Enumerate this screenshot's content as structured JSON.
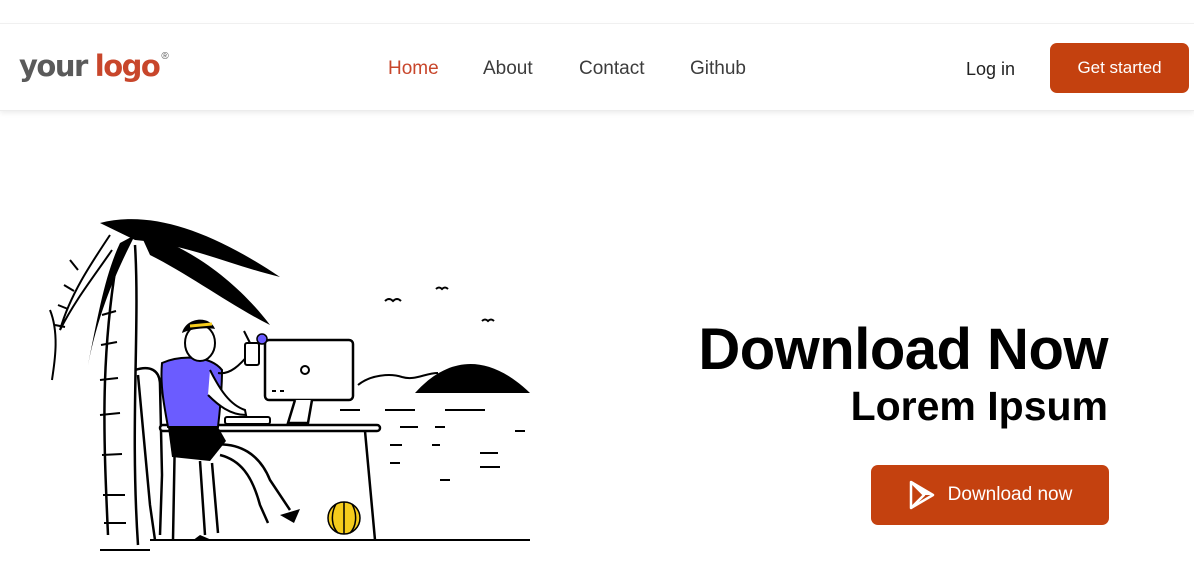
{
  "brand": {
    "logo_part1": "your",
    "logo_part2": "logo",
    "registered": "®"
  },
  "nav": {
    "links": [
      {
        "label": "Home",
        "active": true
      },
      {
        "label": "About",
        "active": false
      },
      {
        "label": "Contact",
        "active": false
      },
      {
        "label": "Github",
        "active": false
      }
    ],
    "login_label": "Log in",
    "cta_label": "Get started"
  },
  "hero": {
    "title": "Download Now",
    "subtitle": "Lorem Ipsum",
    "button_label": "Download now",
    "button_icon": "play-store-icon",
    "illustration": "person-working-on-laptop-under-palm-tree"
  },
  "colors": {
    "accent": "#c4410f",
    "logo_accent": "#c8462b",
    "text": "#3c3c3c",
    "shirt": "#6b5cff",
    "ball": "#f5cc1c"
  }
}
